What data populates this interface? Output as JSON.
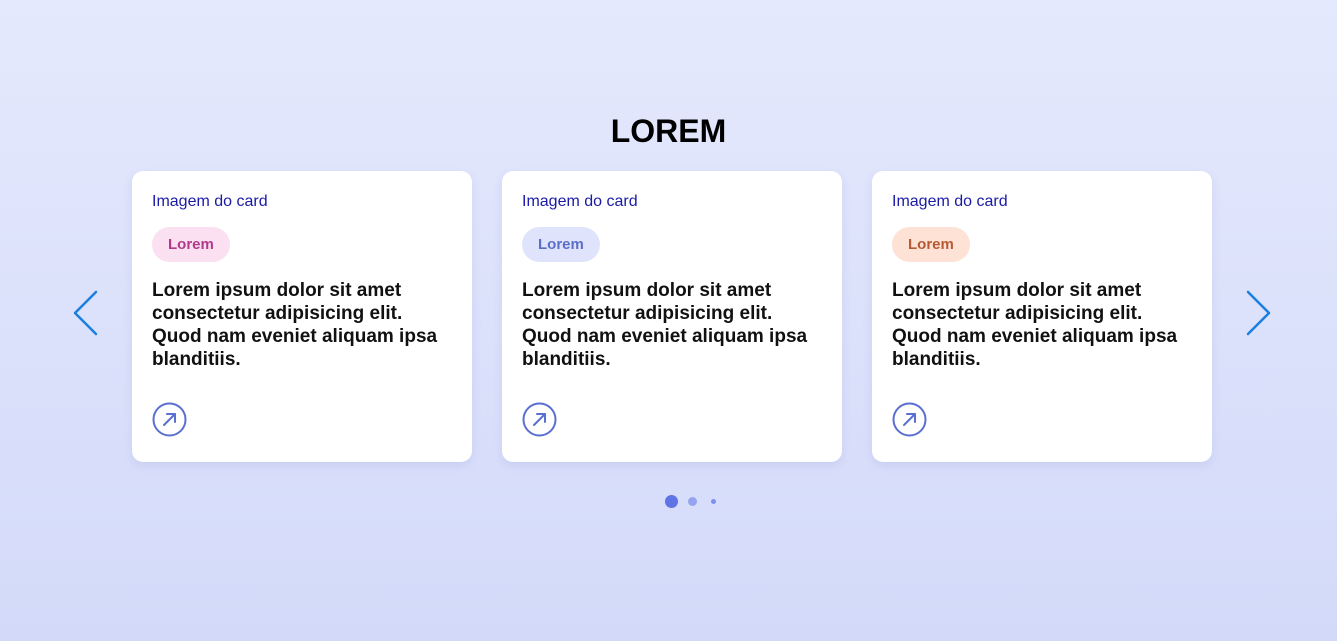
{
  "section": {
    "title": "LOREM"
  },
  "navigation": {
    "prev_icon": "chevron-left-icon",
    "next_icon": "chevron-right-icon",
    "arrow_color": "#1a7fe0"
  },
  "cards": [
    {
      "image_alt": "Imagem do card",
      "tag": "Lorem",
      "tag_bg": "#fbe0f1",
      "tag_color": "#b23a8a",
      "text": "Lorem ipsum dolor sit amet consectetur adipisicing elit. Quod nam eveniet aliquam ipsa blanditiis.",
      "link_icon": "arrow-up-right-icon"
    },
    {
      "image_alt": "Imagem do card",
      "tag": "Lorem",
      "tag_bg": "#dfe4fc",
      "tag_color": "#5c6fc7",
      "text": "Lorem ipsum dolor sit amet consectetur adipisicing elit. Quod nam eveniet aliquam ipsa blanditiis.",
      "link_icon": "arrow-up-right-icon"
    },
    {
      "image_alt": "Imagem do card",
      "tag": "Lorem",
      "tag_bg": "#fde2d5",
      "tag_color": "#b85a33",
      "text": "Lorem ipsum dolor sit amet consectetur adipisicing elit. Quod nam eveniet aliquam ipsa blanditiis.",
      "link_icon": "arrow-up-right-icon"
    }
  ],
  "pagination": {
    "active_index": 1,
    "count": 3,
    "accent": "#5f72e6"
  },
  "colors": {
    "background_top": "#e5e9fd",
    "background_bottom": "#d3daf9",
    "link_icon": "#5a6fd0"
  }
}
